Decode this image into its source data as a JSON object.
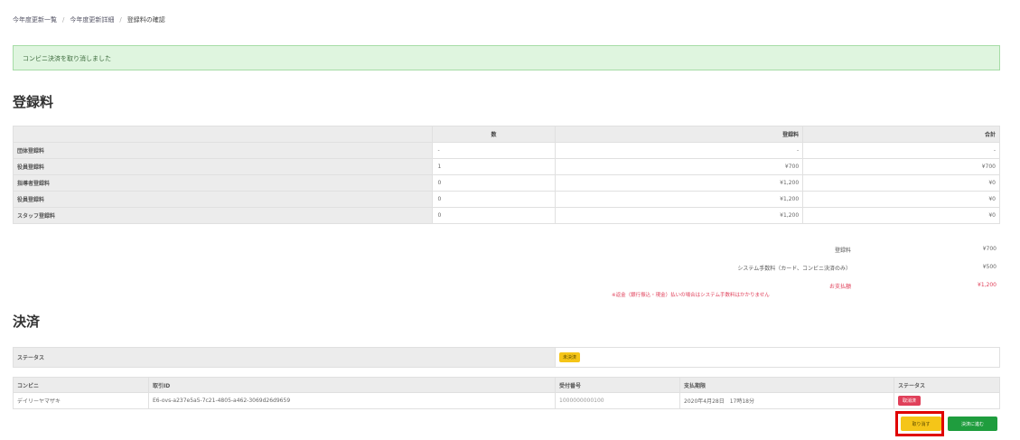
{
  "breadcrumb": {
    "items": [
      "今年度更新一覧",
      "今年度更新詳細",
      "登録料の確認"
    ]
  },
  "alert": {
    "message": "コンビニ決済を取り消しました"
  },
  "fee_section": {
    "title": "登録料",
    "headers": [
      "",
      "数",
      "登録料",
      "合計"
    ],
    "rows": [
      {
        "label": "団体登録料",
        "count": "-",
        "unit": "-",
        "total": "-"
      },
      {
        "label": "役員登録料",
        "count": "1",
        "unit": "¥700",
        "total": "¥700"
      },
      {
        "label": "指導者登録料",
        "count": "0",
        "unit": "¥1,200",
        "total": "¥0"
      },
      {
        "label": "役員登録料",
        "count": "0",
        "unit": "¥1,200",
        "total": "¥0"
      },
      {
        "label": "スタッフ登録料",
        "count": "0",
        "unit": "¥1,200",
        "total": "¥0"
      }
    ],
    "summary": {
      "fee_label": "登録料",
      "fee_value": "¥700",
      "system_label": "システム手数料（カード、コンビニ決済のみ）",
      "system_value": "¥500",
      "due_label": "お支払額",
      "due_value": "¥1,200"
    },
    "note": "※返金（銀行振込・現金）払いの場合はシステム手数料はかかりません"
  },
  "payment_section": {
    "title": "決済",
    "status_label": "ステータス",
    "status_badge": "未決済",
    "headers": [
      "コンビニ",
      "取引ID",
      "受付番号",
      "支払期限",
      "ステータス"
    ],
    "row": {
      "store": "デイリーヤマザキ",
      "transaction_id": "E6-ovs-a237e5a5-7c21-4805-a462-3069d26d9659",
      "receipt_no": "1000000000100",
      "deadline": "2020年4月28日　17時18分",
      "status": "取消済"
    }
  },
  "buttons": {
    "cancel_label": "取り消す",
    "pay_label": "決済に進む"
  },
  "colors": {
    "alert_bg": "#dff5df",
    "accent_yellow": "#f5c518",
    "accent_green": "#1f9d3e",
    "accent_red": "#e0405a",
    "highlight": "#e00000"
  }
}
